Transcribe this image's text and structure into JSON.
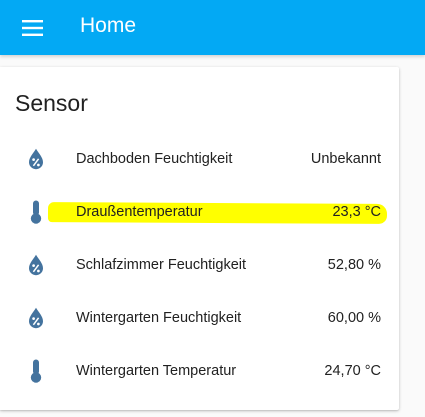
{
  "toolbar": {
    "title": "Home",
    "menu_icon": "hamburger-menu-icon",
    "background_color": "#03a9f4"
  },
  "card": {
    "title": "Sensor",
    "icon_color": "#44739e",
    "highlight_color": "#ffff00",
    "rows": [
      {
        "icon": "water-percent-icon",
        "name": "Dachboden Feuchtigkeit",
        "state": "Unbekannt"
      },
      {
        "icon": "thermometer-icon",
        "name": "Draußentemperatur",
        "state": "23,3 °C",
        "highlighted": true
      },
      {
        "icon": "water-percent-icon",
        "name": "Schlafzimmer Feuchtigkeit",
        "state": "52,80 %"
      },
      {
        "icon": "water-percent-icon",
        "name": "Wintergarten Feuchtigkeit",
        "state": "60,00 %"
      },
      {
        "icon": "thermometer-icon",
        "name": "Wintergarten Temperatur",
        "state": "24,70 °C"
      }
    ]
  }
}
